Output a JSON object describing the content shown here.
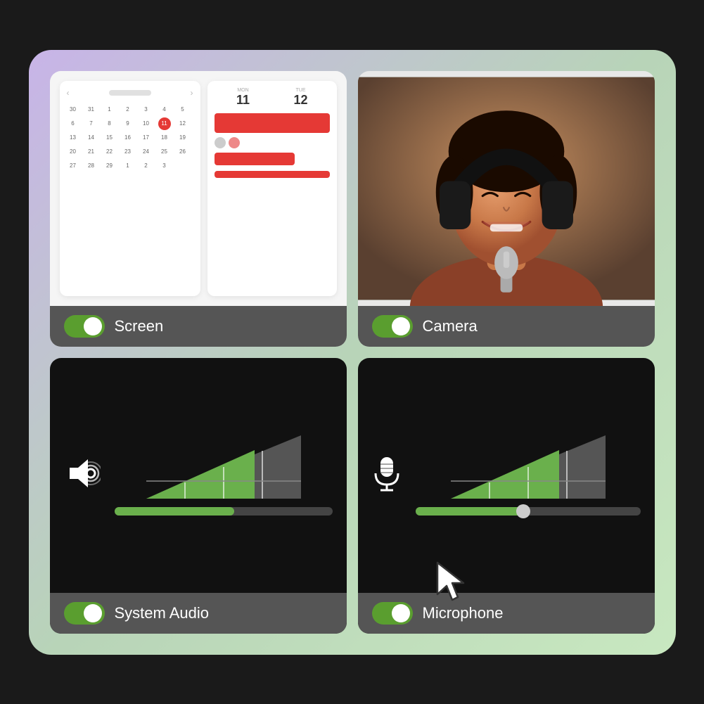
{
  "background": {
    "gradient_start": "#c8b4e8",
    "gradient_end": "#c8e8c0"
  },
  "cards": {
    "screen": {
      "label": "Screen",
      "toggle_on": true,
      "toggle_color": "#5a9e2f"
    },
    "camera": {
      "label": "Camera",
      "toggle_on": true,
      "toggle_color": "#5a9e2f"
    },
    "system_audio": {
      "label": "System Audio",
      "toggle_on": true,
      "toggle_color": "#5a9e2f"
    },
    "microphone": {
      "label": "Microphone",
      "toggle_on": true,
      "toggle_color": "#5a9e2f"
    }
  },
  "calendar": {
    "days": [
      "30",
      "31",
      "1",
      "2",
      "3",
      "4",
      "5",
      "6",
      "7",
      "8",
      "9",
      "10",
      "11",
      "12",
      "13",
      "14",
      "15",
      "16",
      "17",
      "18",
      "19",
      "20",
      "21",
      "22",
      "23",
      "24",
      "25",
      "26",
      "27",
      "28",
      "29",
      "1",
      "2",
      "3"
    ],
    "today": "11",
    "today_index": 12
  },
  "schedule": {
    "day1_num": "11",
    "day1_label": "MON",
    "day2_num": "12",
    "day2_label": "TUE"
  }
}
